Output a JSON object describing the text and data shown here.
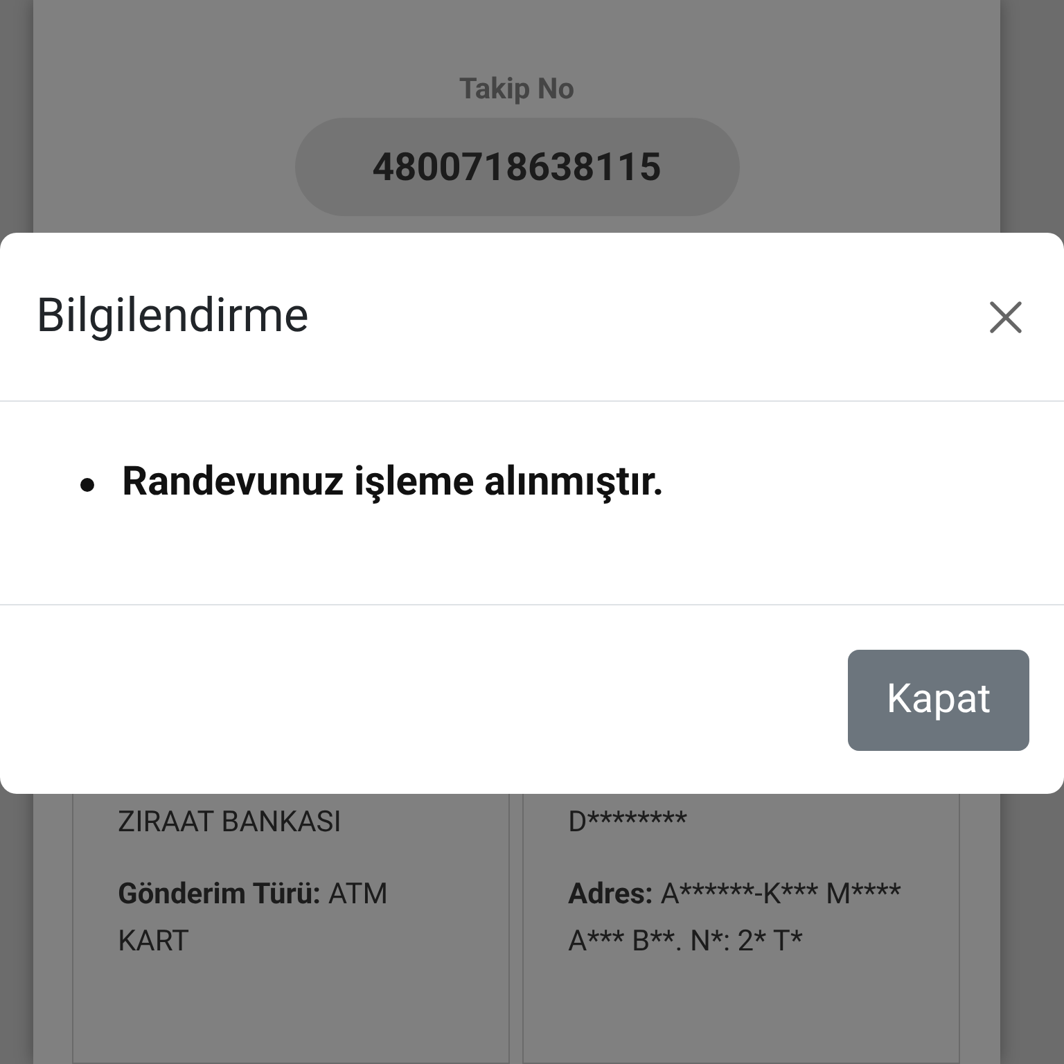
{
  "page": {
    "tracking_label": "Takip No",
    "tracking_number": "4800718638115",
    "cards": [
      {
        "fields": [
          {
            "value": "ZIRAAT BANKASI"
          },
          {
            "label": "Gönderim Türü:",
            "value": "ATM KART"
          }
        ]
      },
      {
        "fields": [
          {
            "value": "D********"
          },
          {
            "label": "Adres:",
            "value": "A******-K*** M**** A*** B**. N*: 2* T*"
          }
        ]
      }
    ]
  },
  "dialog": {
    "title": "Bilgilendirme",
    "items": [
      "Randevunuz işleme alınmıştır."
    ],
    "buttons": [
      "Kapat"
    ]
  }
}
